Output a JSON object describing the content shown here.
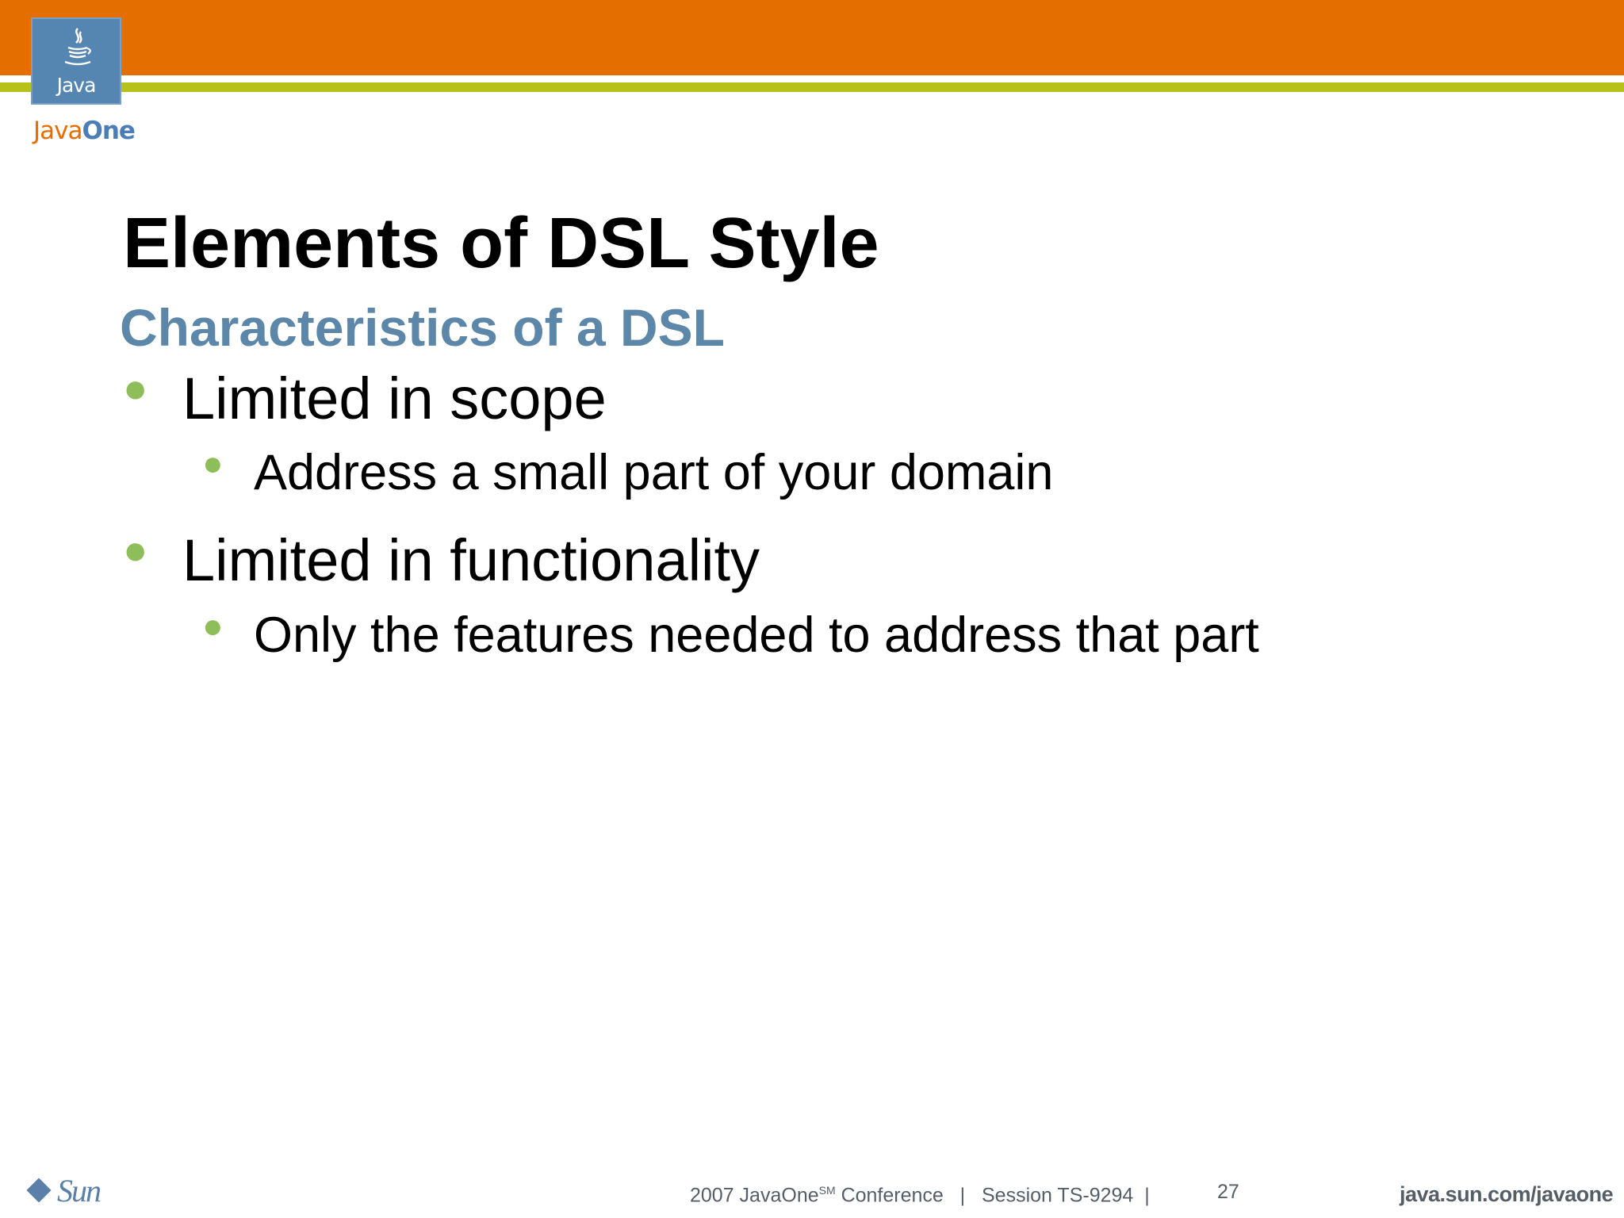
{
  "branding": {
    "java_logo_text": "Java",
    "wordmark_java": "Java",
    "wordmark_one": "One",
    "sun_logo_text": "Sun"
  },
  "slide": {
    "title": "Elements of DSL Style",
    "subtitle": "Characteristics of a DSL",
    "bullets": [
      {
        "text": "Limited in scope",
        "sub": [
          "Address a small part of your domain"
        ]
      },
      {
        "text": "Limited in functionality",
        "sub": [
          "Only the features needed to address that part"
        ]
      }
    ]
  },
  "footer": {
    "conference_prefix": "2007 JavaOne",
    "conference_sup": "SM",
    "conference_suffix": " Conference   |   Session TS-9294  |",
    "page_number": "27",
    "url": "java.sun.com/javaone"
  },
  "colors": {
    "orange_band": "#e56e00",
    "green_band": "#b6c11a",
    "java_logo_bg": "#5585b1",
    "subtitle": "#5d87a8",
    "bullet_dot": "#8dbe5a",
    "footer_text": "#555e66"
  }
}
